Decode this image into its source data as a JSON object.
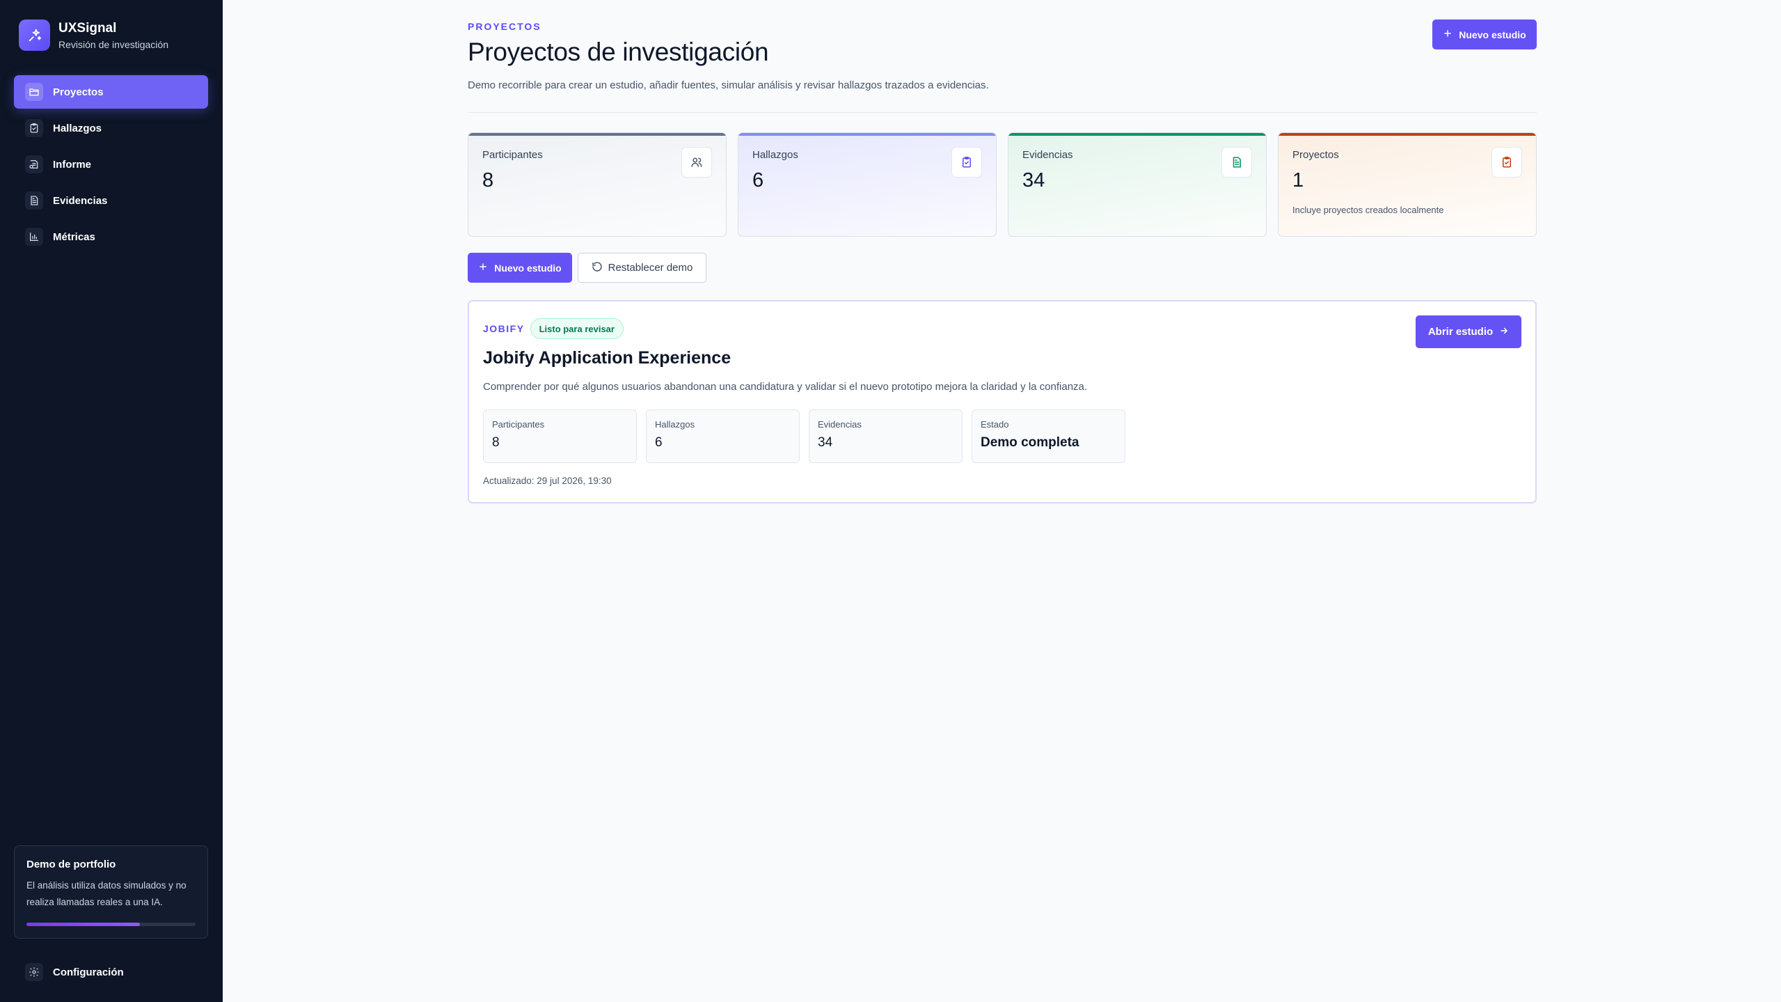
{
  "brand": {
    "name": "UXSignal",
    "subtitle": "Revisión de investigación",
    "icon": "sparkles-icon"
  },
  "sidebar": {
    "items": [
      {
        "label": "Proyectos",
        "icon": "folder-icon",
        "active": true
      },
      {
        "label": "Hallazgos",
        "icon": "clipboard-check-icon",
        "active": false
      },
      {
        "label": "Informe",
        "icon": "report-icon",
        "active": false
      },
      {
        "label": "Evidencias",
        "icon": "document-icon",
        "active": false
      },
      {
        "label": "Métricas",
        "icon": "bar-chart-icon",
        "active": false
      }
    ],
    "demo": {
      "title": "Demo de portfolio",
      "text": "El análisis utiliza datos simulados y no realiza llamadas reales a una IA.",
      "progress": 0.67
    },
    "settings_label": "Configuración"
  },
  "header": {
    "eyebrow": "PROYECTOS",
    "title": "Proyectos de investigación",
    "description": "Demo recorrible para crear un estudio, añadir fuentes, simular análisis y revisar hallazgos trazados a evidencias.",
    "new_study_label": "Nuevo estudio"
  },
  "stats": [
    {
      "label": "Participantes",
      "value": "8",
      "note": "",
      "icon": "users-icon",
      "color": "#64748b"
    },
    {
      "label": "Hallazgos",
      "value": "6",
      "note": "",
      "icon": "clipboard-check-icon",
      "color": "#6366f1"
    },
    {
      "label": "Evidencias",
      "value": "34",
      "note": "",
      "icon": "document-icon",
      "color": "#059669"
    },
    {
      "label": "Proyectos",
      "value": "1",
      "note": "Incluye proyectos creados localmente",
      "icon": "clipboard-check-icon",
      "color": "#c2410c"
    }
  ],
  "actions": {
    "new_study_label": "Nuevo estudio",
    "reset_label": "Restablecer demo"
  },
  "project": {
    "tag": "JOBIFY",
    "status": "Listo para revisar",
    "title": "Jobify Application Experience",
    "description": "Comprender por qué algunos usuarios abandonan una candidatura y validar si el nuevo prototipo mejora la claridad y la confianza.",
    "open_label": "Abrir estudio",
    "metrics": [
      {
        "label": "Participantes",
        "value": "8"
      },
      {
        "label": "Hallazgos",
        "value": "6"
      },
      {
        "label": "Evidencias",
        "value": "34"
      },
      {
        "label": "Estado",
        "value": "Demo completa"
      }
    ],
    "updated": "Actualizado: 29 jul 2026, 19:30"
  },
  "colors": {
    "accent": "#6552f5",
    "sidebar_bg": "#0d1526",
    "page_bg": "#f8fafc"
  }
}
